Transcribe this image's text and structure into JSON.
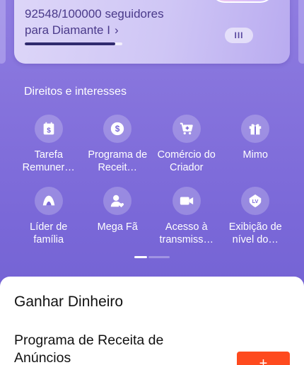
{
  "level_card": {
    "progress_text": "92548/100000 seguidores",
    "target_level": "para Diamante I",
    "chevron": "›",
    "progress_fraction": 0.92548,
    "level_pill": "III"
  },
  "section_title": "Direitos e interesses",
  "benefits": [
    {
      "label": "Tarefa Remuner…",
      "icon": "calendar-dollar-icon"
    },
    {
      "label": "Programa de Receit…",
      "icon": "dollar-coin-icon"
    },
    {
      "label": "Comércio do Criador",
      "icon": "cart-plus-icon"
    },
    {
      "label": "Mimo",
      "icon": "gift-icon"
    },
    {
      "label": "Líder de família",
      "icon": "tent-icon"
    },
    {
      "label": "Mega Fã",
      "icon": "user-heart-icon"
    },
    {
      "label": "Acesso à transmiss…",
      "icon": "video-camera-icon"
    },
    {
      "label": "Exibição de nível do…",
      "icon": "level-badge-icon"
    }
  ],
  "bottom_sheet": {
    "title": "Ganhar Dinheiro",
    "program_title": "Programa de Receita de Anúncios",
    "cta_label": "+"
  },
  "colors": {
    "background": "#7a68d8",
    "cta": "#fe4a1e",
    "progress_fill": "#2f2a6e"
  }
}
